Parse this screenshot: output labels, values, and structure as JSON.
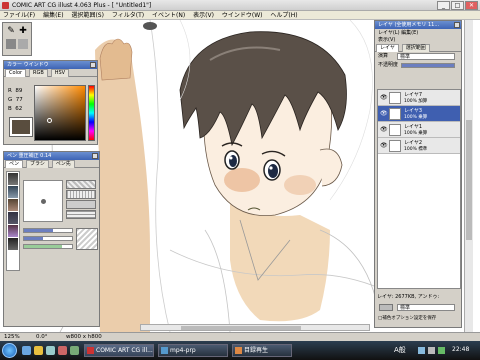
{
  "window": {
    "title": "COMIC ART CG illust 4.063 Plus - [ \"Untitled1\"]",
    "min": "_",
    "max": "□",
    "close": "✕"
  },
  "menu": [
    "ファイル(F)",
    "編集(E)",
    "選択範囲(S)",
    "フィルタ(T)",
    "イベント(N)",
    "表示(V)",
    "ウインドウ(W)",
    "ヘルプ(H)"
  ],
  "color_window": {
    "title": "カラー ウインドウ",
    "tabs": [
      "Color",
      "RGB",
      "HSV"
    ],
    "r_label": "R",
    "r": "89",
    "g_label": "G",
    "g": "77",
    "b_label": "B",
    "b": "62",
    "current_color": "#594d3e"
  },
  "pen_window": {
    "title": "ペン 重圧補正 0.14",
    "tabs": [
      "ペン",
      "ブラシ",
      "ペン先"
    ]
  },
  "layer_window": {
    "title": "レイヤ (全使用メモリ 11...",
    "menu": [
      "レイヤ(L)",
      "編集(E)",
      "表示(V)"
    ],
    "tabs": [
      "レイヤ",
      "選択範囲"
    ],
    "mode_label": "演算",
    "mode_value": "標準",
    "opacity_label": "不透明度",
    "layers": [
      {
        "name": "レイヤ7",
        "mode": "100% 加算",
        "selected": false
      },
      {
        "name": "レイヤ3",
        "mode": "100% 乗算",
        "selected": true
      },
      {
        "name": "レイヤ1",
        "mode": "100% 乗算",
        "selected": false
      },
      {
        "name": "レイヤ2",
        "mode": "100% 標準",
        "selected": false
      }
    ],
    "status": "レイヤ: 2677KB, アンドゥ:",
    "select_label": "標準",
    "checkbox_label": "□補色オプション設定を保存"
  },
  "status_bar": {
    "zoom": "125%",
    "angle": "0.0°",
    "size": "w800 x h800"
  },
  "taskbar": {
    "tasks": [
      "COMIC ART CG ill...",
      "mp4-prp",
      "目録再生"
    ],
    "ime": "A般",
    "time": "22:48"
  }
}
